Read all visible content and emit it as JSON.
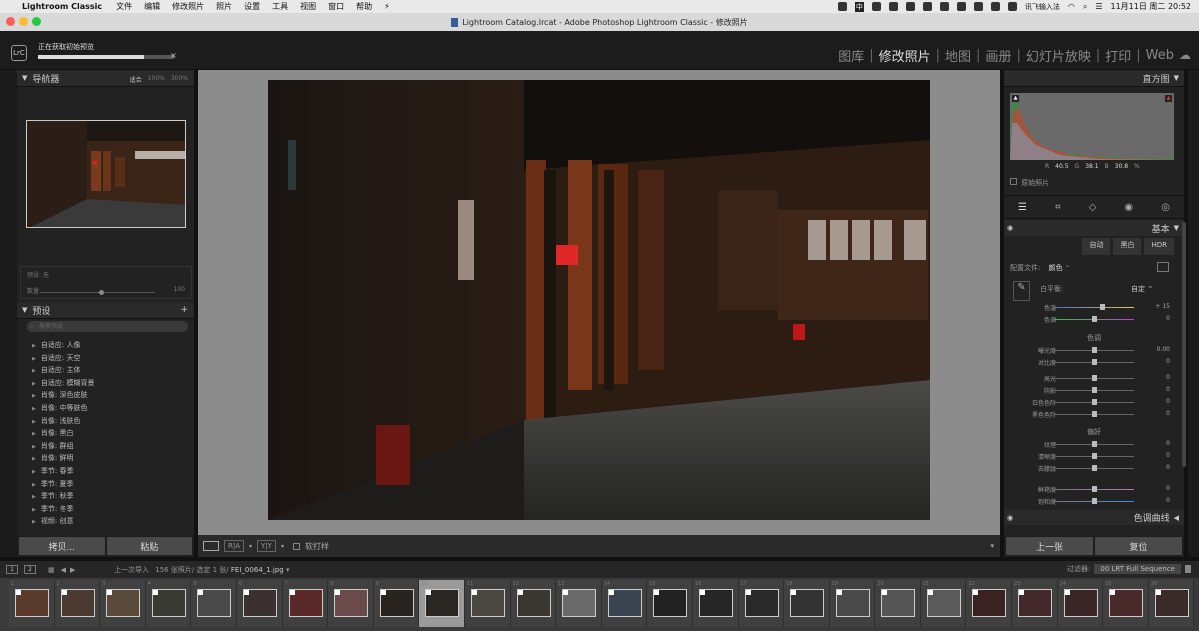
{
  "menubar": {
    "app_name": "Lightroom Classic",
    "items": [
      "文件",
      "编辑",
      "修改照片",
      "照片",
      "设置",
      "工具",
      "视图",
      "窗口",
      "帮助"
    ],
    "clock": "11月11日 周二 20:52",
    "input_method": "讯飞输入法",
    "ime_badge": "中"
  },
  "window": {
    "title": "Lightroom Catalog.lrcat - Adobe Photoshop Lightroom Classic - 修改照片"
  },
  "topbar": {
    "logo": "LrC",
    "progress_label": "正在获取初始预览",
    "progress_fraction": 0.78,
    "modules": [
      {
        "label": "图库",
        "active": false
      },
      {
        "label": "修改照片",
        "active": true
      },
      {
        "label": "地图",
        "active": false
      },
      {
        "label": "画册",
        "active": false
      },
      {
        "label": "幻灯片放映",
        "active": false
      },
      {
        "label": "打印",
        "active": false
      },
      {
        "label": "Web",
        "active": false
      }
    ]
  },
  "navigator": {
    "title": "导航器",
    "zoom_options": [
      {
        "label": "适合",
        "selected": true
      },
      {
        "label": "100%",
        "selected": false
      },
      {
        "label": "300%",
        "selected": false
      }
    ]
  },
  "preset_amount": {
    "label": "预设: 无",
    "amount_label": "数量",
    "amount_value": "100"
  },
  "presets": {
    "title": "预设",
    "add": "+",
    "search_placeholder": "搜索预设",
    "items": [
      "自适应: 人像",
      "自适应: 天空",
      "自适应: 主体",
      "自适应: 模糊背景",
      "肖像: 深色皮肤",
      "肖像: 中等肤色",
      "肖像: 浅肤色",
      "肖像: 黑白",
      "肖像: 群组",
      "肖像: 鲜明",
      "季节: 春季",
      "季节: 夏季",
      "季节: 秋季",
      "季节: 冬季",
      "视频: 创意"
    ]
  },
  "left_buttons": {
    "copy": "拷贝...",
    "paste": "粘贴"
  },
  "toolbar": {
    "ref_a": "R|A",
    "ref_b": "Y|Y",
    "softproof": "软打样"
  },
  "histogram": {
    "title": "直方图",
    "r_label": "R",
    "r": "40.5",
    "g_label": "G",
    "g": "38.1",
    "b_label": "B",
    "b": "30.8",
    "unit": "%",
    "original_photo": "原始照片"
  },
  "basic": {
    "title": "基本",
    "treatments": [
      "自动",
      "黑白",
      "HDR"
    ],
    "profile_label": "配置文件:",
    "profile_value": "颜色",
    "wb_label": "白平衡:",
    "wb_value": "自定",
    "sliders": [
      {
        "label": "色温",
        "value": "+ 15",
        "pos": 0.6
      },
      {
        "label": "色调",
        "value": "0",
        "pos": 0.5
      }
    ],
    "tone_title": "色调",
    "tone_sliders": [
      {
        "label": "曝光度",
        "value": "0.00",
        "pos": 0.5
      },
      {
        "label": "对比度",
        "value": "0",
        "pos": 0.5
      },
      {
        "label": "高光",
        "value": "0",
        "pos": 0.5
      },
      {
        "label": "阴影",
        "value": "0",
        "pos": 0.5
      },
      {
        "label": "白色色阶",
        "value": "0",
        "pos": 0.5
      },
      {
        "label": "黑色色阶",
        "value": "0",
        "pos": 0.5
      }
    ],
    "presence_title": "偏好",
    "presence_sliders": [
      {
        "label": "纹理",
        "value": "0",
        "pos": 0.5
      },
      {
        "label": "清晰度",
        "value": "0",
        "pos": 0.5
      },
      {
        "label": "去朦胧",
        "value": "0",
        "pos": 0.5
      },
      {
        "label": "鲜艳度",
        "value": "0",
        "pos": 0.5
      },
      {
        "label": "饱和度",
        "value": "0",
        "pos": 0.5
      }
    ]
  },
  "tone_curve": {
    "title": "色调曲线"
  },
  "right_buttons": {
    "previous": "上一张",
    "reset": "复位"
  },
  "filmstrip_bar": {
    "view1": "1",
    "view2": "2",
    "source": "上一次导入",
    "count": "156 张照片/ 选定 1 张/",
    "filename": "FEI_0064_1.jpg",
    "filter_label": "过滤器:",
    "filter_value": "00 LRT Full Sequence"
  },
  "filmstrip": {
    "selected_index": 9,
    "thumbs": [
      {
        "num": "1",
        "c": "#5a3a2a"
      },
      {
        "num": "2",
        "c": "#4a3a30"
      },
      {
        "num": "3",
        "c": "#5a4a3a"
      },
      {
        "num": "4",
        "c": "#3a3a34"
      },
      {
        "num": "5",
        "c": "#4a4a4a"
      },
      {
        "num": "6",
        "c": "#3a3030"
      },
      {
        "num": "7",
        "c": "#5a2828"
      },
      {
        "num": "8",
        "c": "#6a4a4a"
      },
      {
        "num": "9",
        "c": "#2a2420"
      },
      {
        "num": "10",
        "c": "#2a2622"
      },
      {
        "num": "11",
        "c": "#4a4640"
      },
      {
        "num": "12",
        "c": "#3a3630"
      },
      {
        "num": "13",
        "c": "#6a6a6a"
      },
      {
        "num": "14",
        "c": "#3a4450"
      },
      {
        "num": "15",
        "c": "#222"
      },
      {
        "num": "16",
        "c": "#262626"
      },
      {
        "num": "17",
        "c": "#2a2a2a"
      },
      {
        "num": "18",
        "c": "#333"
      },
      {
        "num": "19",
        "c": "#4a4a4a"
      },
      {
        "num": "20",
        "c": "#555"
      },
      {
        "num": "21",
        "c": "#5a5a5a"
      },
      {
        "num": "22",
        "c": "#3a2222"
      },
      {
        "num": "23",
        "c": "#442a2a"
      },
      {
        "num": "24",
        "c": "#3a2626"
      },
      {
        "num": "25",
        "c": "#4a2a2a"
      },
      {
        "num": "26",
        "c": "#3a2a2a"
      }
    ]
  }
}
